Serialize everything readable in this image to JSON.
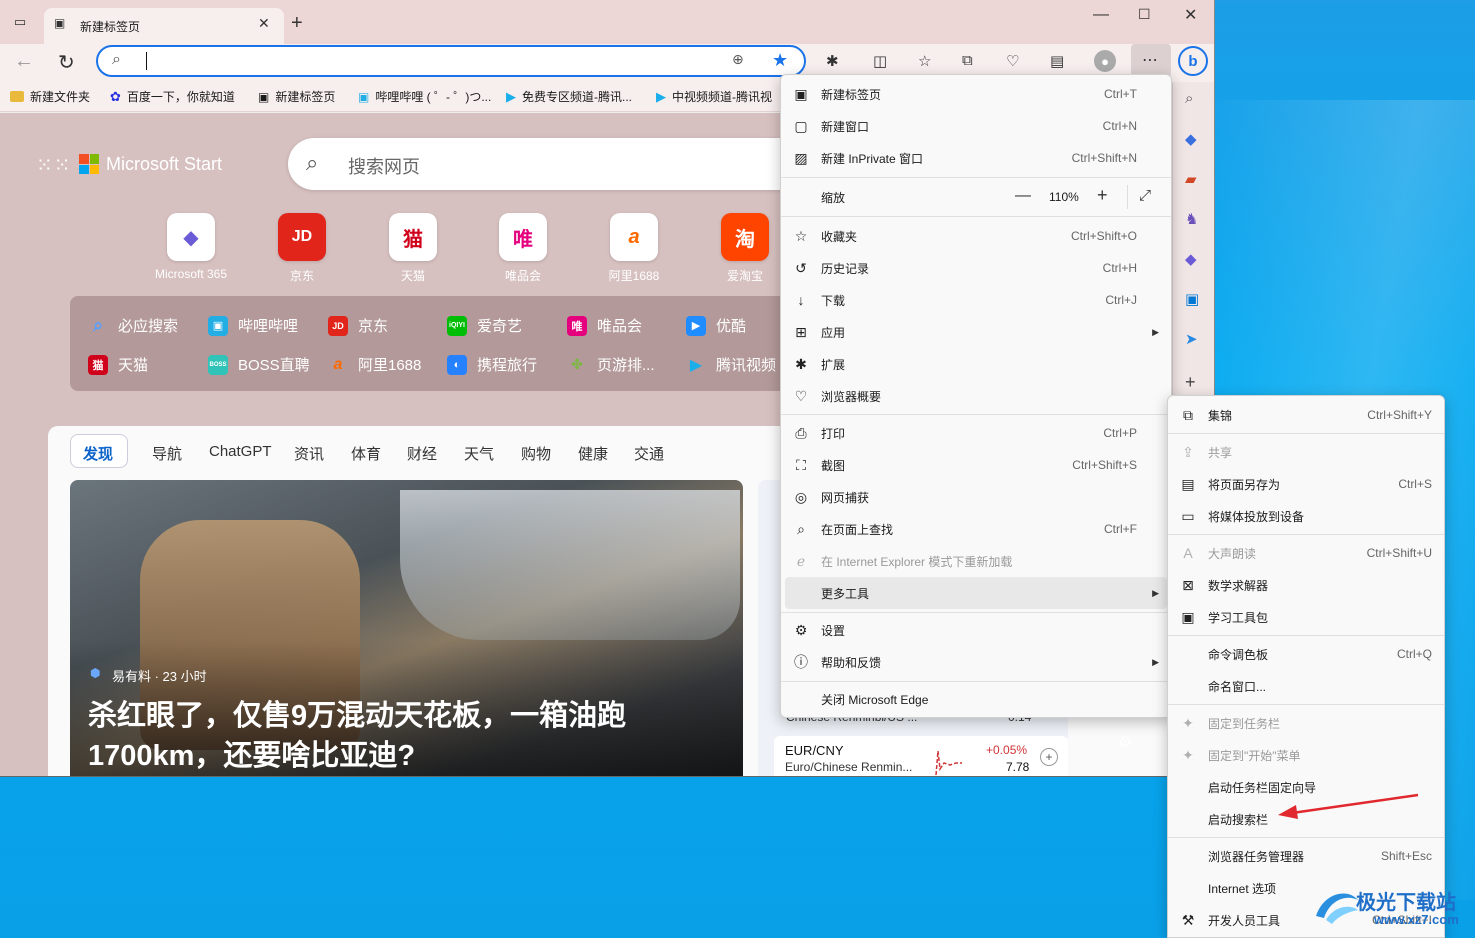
{
  "browser": {
    "tab_title": "新建标签页",
    "address_value": "",
    "favorites": [
      {
        "label": "新建文件夹",
        "icon": "folder-icon"
      },
      {
        "label": "百度一下，你就知道",
        "icon": "baidu-icon"
      },
      {
        "label": "新建标签页",
        "icon": "newtab-icon"
      },
      {
        "label": "哔哩哔哩 ( ゜- ゜)つ...",
        "icon": "bilibili-icon"
      },
      {
        "label": "免费专区频道-腾讯...",
        "icon": "tencent-video-icon"
      },
      {
        "label": "中视频频道-腾讯视",
        "icon": "tencent-video-icon"
      }
    ]
  },
  "newtab": {
    "brand": "Microsoft Start",
    "search_placeholder": "搜索网页",
    "shortcuts": [
      {
        "label": "Microsoft 365",
        "glyph": "◆",
        "color": "#6b5bd6"
      },
      {
        "label": "京东",
        "glyph": "JD",
        "color": "#e1251b"
      },
      {
        "label": "天猫",
        "glyph": "猫",
        "color": "#d0021b"
      },
      {
        "label": "唯品会",
        "glyph": "唯",
        "color": "#e5007e"
      },
      {
        "label": "阿里1688",
        "glyph": "a",
        "color": "#ff6a00"
      },
      {
        "label": "爱淘宝",
        "glyph": "淘",
        "color": "#ff4400"
      }
    ],
    "quick_links_row1": [
      {
        "label": "必应搜索",
        "color": "#2a7ae2"
      },
      {
        "label": "哔哩哔哩",
        "color": "#23ade5"
      },
      {
        "label": "京东",
        "color": "#e1251b"
      },
      {
        "label": "爱奇艺",
        "color": "#00be06"
      },
      {
        "label": "唯品会",
        "color": "#e5007e"
      },
      {
        "label": "优酷",
        "color": "#1f8cff"
      }
    ],
    "quick_links_row2": [
      {
        "label": "天猫",
        "color": "#d0021b"
      },
      {
        "label": "BOSS直聘",
        "color": "#30c4b8"
      },
      {
        "label": "阿里1688",
        "color": "#ff6a00"
      },
      {
        "label": "携程旅行",
        "color": "#2681ff"
      },
      {
        "label": "页游排...",
        "color": "#7db842"
      },
      {
        "label": "腾讯视频",
        "color": "#1aaeea"
      }
    ],
    "feed_tabs": [
      "发现",
      "导航",
      "ChatGPT",
      "资讯",
      "体育",
      "财经",
      "天气",
      "购物",
      "健康",
      "交通"
    ],
    "article": {
      "source": "易有料 · 23 小时",
      "headline_line1": "杀红眼了，仅售9万混动天花板，一箱油跑",
      "headline_line2": "1700km，还要啥比亚迪?"
    },
    "currency": {
      "partial_text": "Chinese Renminbi/US ...",
      "partial_value": "0.14",
      "pair": "EUR/CNY",
      "name": "Euro/Chinese Renmin...",
      "change": "+0.05%",
      "value": "7.78"
    }
  },
  "main_menu": {
    "items": [
      {
        "label": "新建标签页",
        "shortcut": "Ctrl+T",
        "icon": "new-tab-icon",
        "glyph": "▣"
      },
      {
        "label": "新建窗口",
        "shortcut": "Ctrl+N",
        "icon": "new-window-icon",
        "glyph": "▢"
      },
      {
        "label": "新建 InPrivate 窗口",
        "shortcut": "Ctrl+Shift+N",
        "icon": "inprivate-icon",
        "glyph": "▨"
      }
    ],
    "zoom_label": "缩放",
    "zoom_value": "110%",
    "items2": [
      {
        "label": "收藏夹",
        "shortcut": "Ctrl+Shift+O",
        "icon": "favorites-icon",
        "glyph": "☆"
      },
      {
        "label": "历史记录",
        "shortcut": "Ctrl+H",
        "icon": "history-icon",
        "glyph": "↺"
      },
      {
        "label": "下载",
        "shortcut": "Ctrl+J",
        "icon": "download-icon",
        "glyph": "↓"
      },
      {
        "label": "应用",
        "shortcut": "",
        "icon": "apps-icon",
        "glyph": "⊞",
        "submenu": true
      },
      {
        "label": "扩展",
        "shortcut": "",
        "icon": "extensions-icon",
        "glyph": "✱"
      },
      {
        "label": "浏览器概要",
        "shortcut": "",
        "icon": "essentials-icon",
        "glyph": "♡"
      }
    ],
    "items3": [
      {
        "label": "打印",
        "shortcut": "Ctrl+P",
        "icon": "print-icon",
        "glyph": "⎙"
      },
      {
        "label": "截图",
        "shortcut": "Ctrl+Shift+S",
        "icon": "screenshot-icon",
        "glyph": "⛶"
      },
      {
        "label": "网页捕获",
        "shortcut": "",
        "icon": "web-capture-icon",
        "glyph": "◎"
      },
      {
        "label": "在页面上查找",
        "shortcut": "Ctrl+F",
        "icon": "find-icon",
        "glyph": "⌕"
      },
      {
        "label": "在 Internet Explorer 模式下重新加载",
        "shortcut": "",
        "icon": "ie-mode-icon",
        "glyph": "e",
        "disabled": true
      },
      {
        "label": "更多工具",
        "shortcut": "",
        "icon": "more-tools-icon",
        "glyph": "",
        "submenu": true,
        "highlight": true
      }
    ],
    "items4": [
      {
        "label": "设置",
        "shortcut": "",
        "icon": "settings-icon",
        "glyph": "⚙"
      },
      {
        "label": "帮助和反馈",
        "shortcut": "",
        "icon": "help-icon",
        "glyph": "?",
        "submenu": true
      }
    ],
    "close_label": "关闭 Microsoft Edge"
  },
  "sub_menu": {
    "groups": [
      [
        {
          "label": "集锦",
          "shortcut": "Ctrl+Shift+Y",
          "icon": "collections-icon",
          "glyph": "⧉"
        }
      ],
      [
        {
          "label": "共享",
          "shortcut": "",
          "icon": "share-icon",
          "glyph": "⇪",
          "disabled": true
        },
        {
          "label": "将页面另存为",
          "shortcut": "Ctrl+S",
          "icon": "save-page-icon",
          "glyph": "▤"
        },
        {
          "label": "将媒体投放到设备",
          "shortcut": "",
          "icon": "cast-icon",
          "glyph": "▭"
        }
      ],
      [
        {
          "label": "大声朗读",
          "shortcut": "Ctrl+Shift+U",
          "icon": "read-aloud-icon",
          "glyph": "A",
          "disabled": true
        },
        {
          "label": "数学求解器",
          "shortcut": "",
          "icon": "math-solver-icon",
          "glyph": "⊠"
        },
        {
          "label": "学习工具包",
          "shortcut": "",
          "icon": "learning-toolkit-icon",
          "glyph": "▣"
        }
      ],
      [
        {
          "label": "命令调色板",
          "shortcut": "Ctrl+Q",
          "icon": "",
          "glyph": ""
        },
        {
          "label": "命名窗口...",
          "shortcut": "",
          "icon": "",
          "glyph": ""
        }
      ],
      [
        {
          "label": "固定到任务栏",
          "shortcut": "",
          "icon": "pin-taskbar-icon",
          "glyph": "✦",
          "disabled": true
        },
        {
          "label": "固定到\"开始\"菜单",
          "shortcut": "",
          "icon": "pin-start-icon",
          "glyph": "✦",
          "disabled": true
        },
        {
          "label": "启动任务栏固定向导",
          "shortcut": "",
          "icon": "",
          "glyph": ""
        },
        {
          "label": "启动搜索栏",
          "shortcut": "",
          "icon": "",
          "glyph": ""
        }
      ],
      [
        {
          "label": "浏览器任务管理器",
          "shortcut": "Shift+Esc",
          "icon": "",
          "glyph": ""
        },
        {
          "label": "Internet 选项",
          "shortcut": "",
          "icon": "",
          "glyph": ""
        },
        {
          "label": "开发人员工具",
          "shortcut": "Ctrl+Shift+I",
          "icon": "devtools-icon",
          "glyph": "⚒"
        }
      ]
    ]
  },
  "watermark": {
    "text": "极光下载站",
    "url": "www.xz7.com"
  },
  "colors": {
    "accent": "#0a63c9",
    "arrow": "#e0282e"
  }
}
